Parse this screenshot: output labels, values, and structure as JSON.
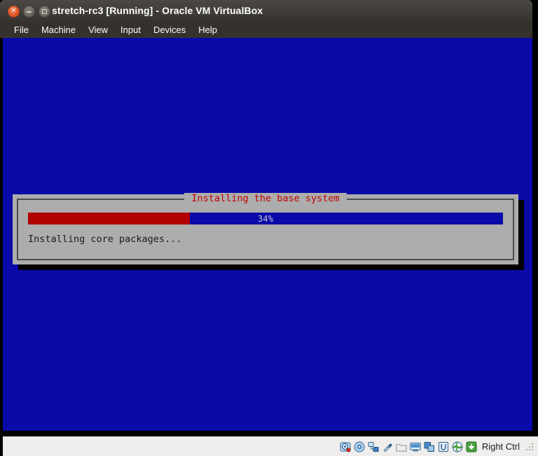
{
  "window": {
    "title": "stretch-rc3 [Running] - Oracle VM VirtualBox",
    "buttons": {
      "close": "close-button",
      "minimize": "minimize-button",
      "maximize": "maximize-button"
    }
  },
  "menubar": {
    "items": [
      {
        "label": "File"
      },
      {
        "label": "Machine"
      },
      {
        "label": "View"
      },
      {
        "label": "Input"
      },
      {
        "label": "Devices"
      },
      {
        "label": "Help"
      }
    ]
  },
  "vm_screen": {
    "background_color": "#0a0aa8"
  },
  "installer_dialog": {
    "title": "Installing the base system",
    "title_color": "#c00000",
    "background_color": "#adadad",
    "progress": {
      "percent_label": "34%",
      "percent_value": 34,
      "fill_color": "#b00000",
      "track_color": "#0a0aa8"
    },
    "status_text": "Installing core packages..."
  },
  "statusbar": {
    "icons": [
      {
        "name": "hard-disk-icon",
        "title": "Hard Disks"
      },
      {
        "name": "optical-disk-icon",
        "title": "Optical Drives"
      },
      {
        "name": "network-icon",
        "title": "Network"
      },
      {
        "name": "usb-icon",
        "title": "USB Devices"
      },
      {
        "name": "shared-folders-icon",
        "title": "Shared Folders"
      },
      {
        "name": "display-icon",
        "title": "Display"
      },
      {
        "name": "recording-icon",
        "title": "Recording"
      },
      {
        "name": "virtualization-icon",
        "title": "Virtualization"
      },
      {
        "name": "mouse-integration-icon",
        "title": "Mouse Integration"
      },
      {
        "name": "host-key-icon",
        "title": "Host Key"
      }
    ],
    "host_key_label": "Right Ctrl"
  }
}
